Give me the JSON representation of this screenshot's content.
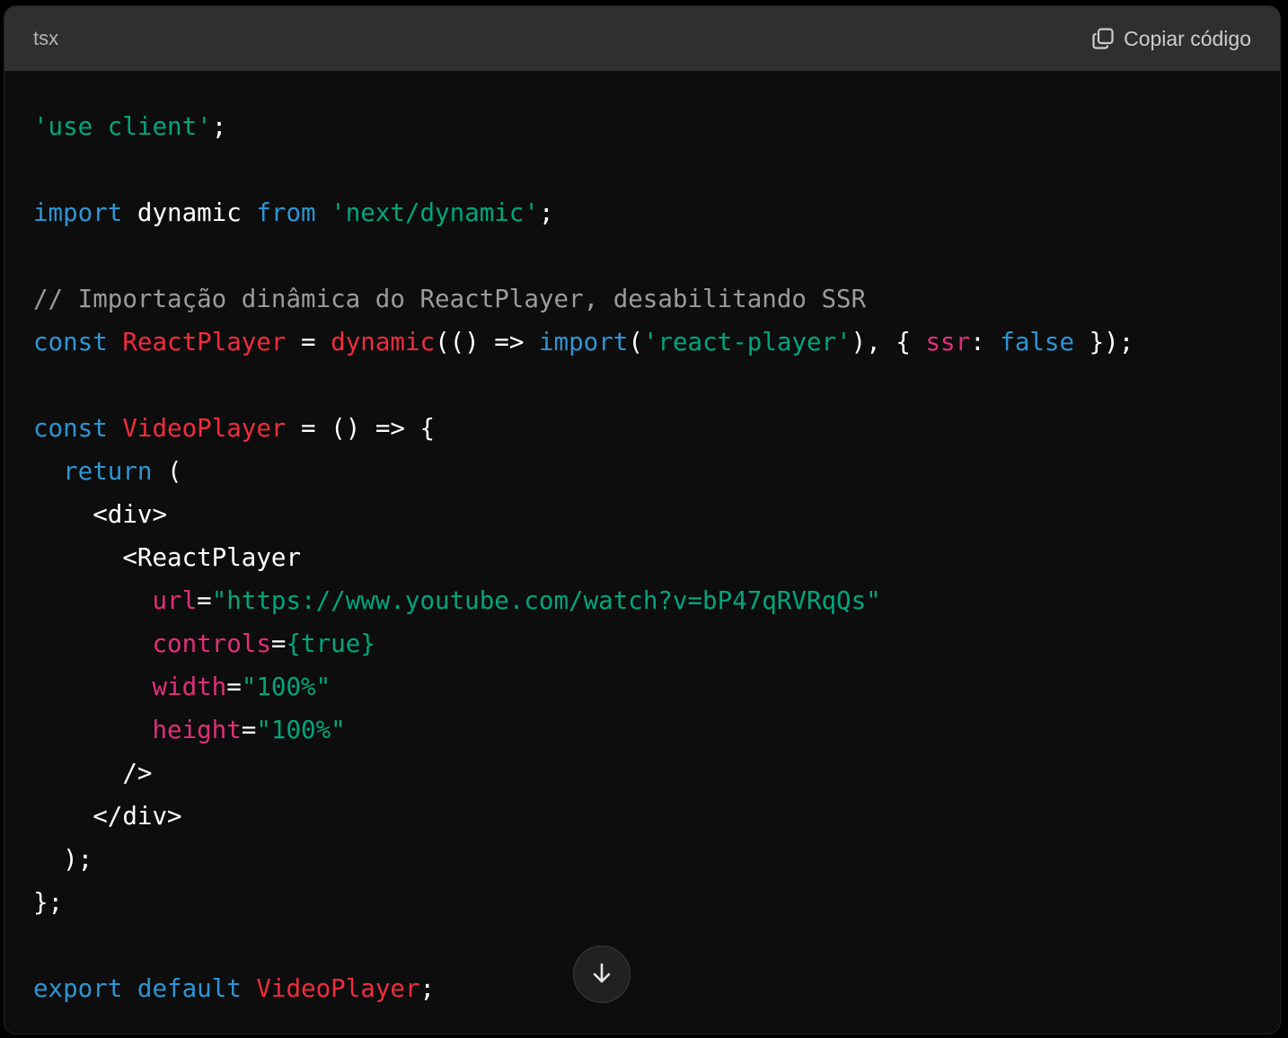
{
  "header": {
    "language": "tsx",
    "copy_label": "Copiar código",
    "copy_icon": "copy-icon"
  },
  "code_lines": [
    [
      {
        "t": "'use client'",
        "c": "str"
      },
      {
        "t": ";",
        "c": ""
      }
    ],
    [],
    [
      {
        "t": "import",
        "c": "kw"
      },
      {
        "t": " dynamic ",
        "c": ""
      },
      {
        "t": "from",
        "c": "kw"
      },
      {
        "t": " ",
        "c": ""
      },
      {
        "t": "'next/dynamic'",
        "c": "str"
      },
      {
        "t": ";",
        "c": ""
      }
    ],
    [],
    [
      {
        "t": "// Importação dinâmica do ReactPlayer, desabilitando SSR",
        "c": "cm"
      }
    ],
    [
      {
        "t": "const",
        "c": "kw"
      },
      {
        "t": " ",
        "c": ""
      },
      {
        "t": "ReactPlayer",
        "c": "fn"
      },
      {
        "t": " = ",
        "c": ""
      },
      {
        "t": "dynamic",
        "c": "fn"
      },
      {
        "t": "(() => ",
        "c": ""
      },
      {
        "t": "import",
        "c": "kw"
      },
      {
        "t": "(",
        "c": ""
      },
      {
        "t": "'react-player'",
        "c": "str"
      },
      {
        "t": "), { ",
        "c": ""
      },
      {
        "t": "ssr",
        "c": "attr"
      },
      {
        "t": ": ",
        "c": ""
      },
      {
        "t": "false",
        "c": "kw"
      },
      {
        "t": " });",
        "c": ""
      }
    ],
    [],
    [
      {
        "t": "const",
        "c": "kw"
      },
      {
        "t": " ",
        "c": ""
      },
      {
        "t": "VideoPlayer",
        "c": "fn"
      },
      {
        "t": " = () => {",
        "c": ""
      }
    ],
    [
      {
        "t": "  ",
        "c": ""
      },
      {
        "t": "return",
        "c": "kw"
      },
      {
        "t": " (",
        "c": ""
      }
    ],
    [
      {
        "t": "    <div>",
        "c": ""
      }
    ],
    [
      {
        "t": "      <ReactPlayer",
        "c": ""
      }
    ],
    [
      {
        "t": "        ",
        "c": ""
      },
      {
        "t": "url",
        "c": "attr"
      },
      {
        "t": "=",
        "c": ""
      },
      {
        "t": "\"https://www.youtube.com/watch?v=bP47qRVRqQs\"",
        "c": "str"
      }
    ],
    [
      {
        "t": "        ",
        "c": ""
      },
      {
        "t": "controls",
        "c": "attr"
      },
      {
        "t": "=",
        "c": ""
      },
      {
        "t": "{true}",
        "c": "str"
      }
    ],
    [
      {
        "t": "        ",
        "c": ""
      },
      {
        "t": "width",
        "c": "attr"
      },
      {
        "t": "=",
        "c": ""
      },
      {
        "t": "\"100%\"",
        "c": "str"
      }
    ],
    [
      {
        "t": "        ",
        "c": ""
      },
      {
        "t": "height",
        "c": "attr"
      },
      {
        "t": "=",
        "c": ""
      },
      {
        "t": "\"100%\"",
        "c": "str"
      }
    ],
    [
      {
        "t": "      />",
        "c": ""
      }
    ],
    [
      {
        "t": "    </div>",
        "c": ""
      }
    ],
    [
      {
        "t": "  );",
        "c": ""
      }
    ],
    [
      {
        "t": "};",
        "c": ""
      }
    ],
    [],
    [
      {
        "t": "export",
        "c": "kw"
      },
      {
        "t": " ",
        "c": ""
      },
      {
        "t": "default",
        "c": "kw"
      },
      {
        "t": " ",
        "c": ""
      },
      {
        "t": "VideoPlayer",
        "c": "fn"
      },
      {
        "t": ";",
        "c": ""
      }
    ]
  ],
  "scroll_button": {
    "icon": "arrow-down-icon"
  },
  "colors": {
    "background": "#0d0d0d",
    "header_bg": "#2f2f2f",
    "keyword": "#2e95d3",
    "string": "#00a67d",
    "comment": "#9b9b9b",
    "identifier": "#f22c3d",
    "attribute": "#df3079"
  }
}
